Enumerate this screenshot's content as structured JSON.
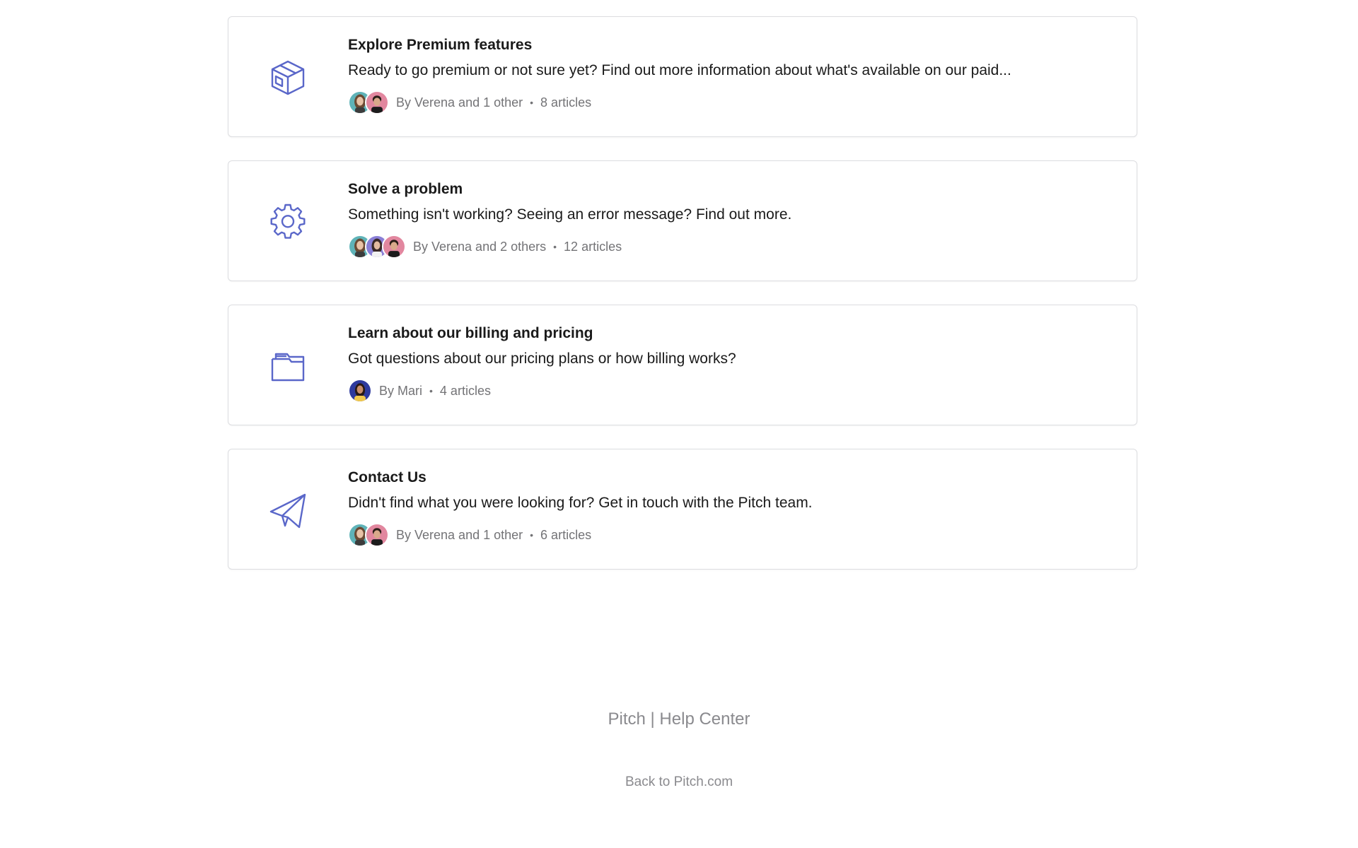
{
  "accent_color": "#5a67c9",
  "collections": [
    {
      "icon": "box-icon",
      "title": "Explore Premium features",
      "description": "Ready to go premium or not sure yet? Find out more information about what's available on our paid...",
      "authors": "By Verena and 1 other",
      "separator": "•",
      "articles": "8 articles",
      "avatars": [
        "verena",
        "man-dark-hair"
      ]
    },
    {
      "icon": "gear-icon",
      "title": "Solve a problem",
      "description": "Something isn't working? Seeing an error message? Find out more.",
      "authors": "By Verena and 2 others",
      "separator": "•",
      "articles": "12 articles",
      "avatars": [
        "verena",
        "woman-purple",
        "man-dark-hair"
      ]
    },
    {
      "icon": "folder-icon",
      "title": "Learn about our billing and pricing",
      "description": "Got questions about our pricing plans or how billing works?",
      "authors": "By Mari",
      "separator": "•",
      "articles": "4 articles",
      "avatars": [
        "mari"
      ]
    },
    {
      "icon": "paper-plane-icon",
      "title": "Contact Us",
      "description": "Didn't find what you were looking for? Get in touch with the Pitch team.",
      "authors": "By Verena and 1 other",
      "separator": "•",
      "articles": "6 articles",
      "avatars": [
        "verena",
        "man-dark-hair"
      ]
    }
  ],
  "footer": {
    "title": "Pitch | Help Center",
    "back_link": "Back to Pitch.com"
  }
}
